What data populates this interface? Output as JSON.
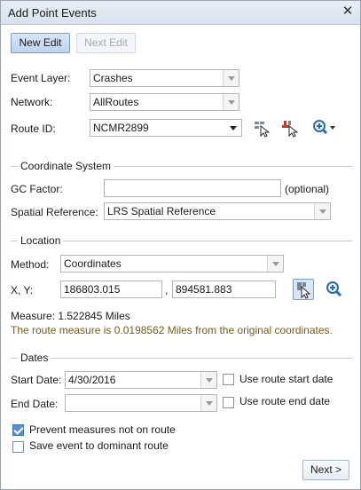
{
  "window": {
    "title": "Add Point Events",
    "close_glyph": "✕"
  },
  "toolbar": {
    "new_edit": "New Edit",
    "next_edit": "Next Edit"
  },
  "fields": {
    "event_layer": {
      "label": "Event Layer:",
      "value": "Crashes"
    },
    "network": {
      "label": "Network:",
      "value": "AllRoutes"
    },
    "route_id": {
      "label": "Route ID:",
      "value": "NCMR2899"
    }
  },
  "coordinate_system": {
    "title": "Coordinate System",
    "gc_factor": {
      "label": "GC Factor:",
      "value": "",
      "hint": "(optional)"
    },
    "spatial_reference": {
      "label": "Spatial Reference:",
      "value": "LRS Spatial Reference"
    }
  },
  "location": {
    "title": "Location",
    "method": {
      "label": "Method:",
      "value": "Coordinates"
    },
    "xy": {
      "label": "X, Y:",
      "x": "186803.015",
      "separator": ",",
      "y": "894581.883"
    },
    "measure": "Measure: 1.522845 Miles",
    "note": "The route measure is 0.0198562 Miles from the original coordinates."
  },
  "dates": {
    "title": "Dates",
    "start": {
      "label": "Start Date:",
      "value": "4/30/2016",
      "checkbox_label": "Use route start date",
      "checked": false
    },
    "end": {
      "label": "End Date:",
      "value": "",
      "checkbox_label": "Use route end date",
      "checked": false
    }
  },
  "options": {
    "prevent_measures": {
      "label": "Prevent measures not on route",
      "checked": true
    },
    "save_dominant": {
      "label": "Save event to dominant route",
      "checked": false
    }
  },
  "footer": {
    "next": "Next >"
  },
  "icons": {
    "select_route": "select-route-icon",
    "pick_route_red": "pick-route-icon",
    "zoom": "zoom-icon",
    "pick_coords": "pick-coordinates-icon",
    "zoom_coords": "zoom-to-coordinates-icon"
  },
  "colors": {
    "accent": "#5b8fd0",
    "note": "#7a5a1a"
  }
}
